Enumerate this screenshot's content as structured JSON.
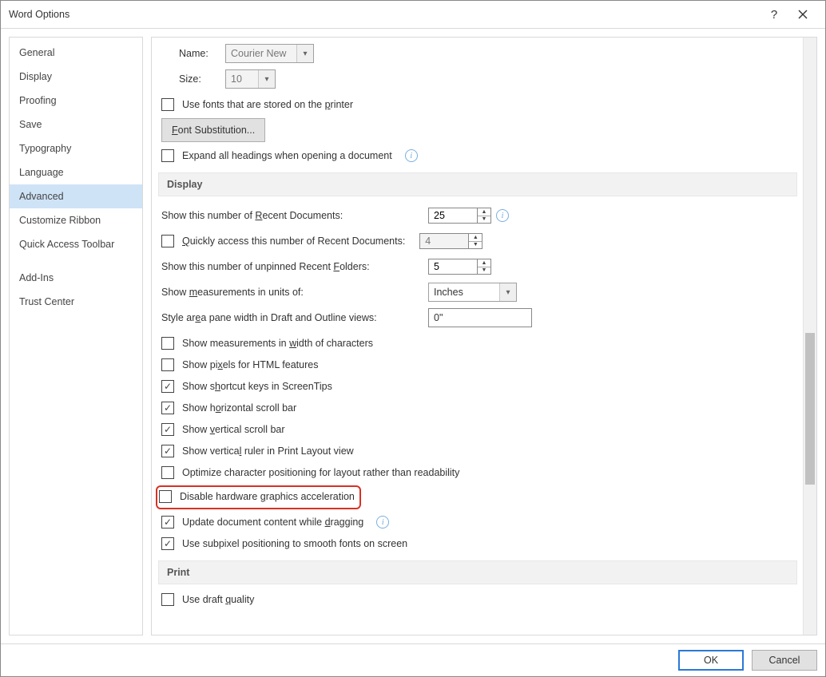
{
  "title": "Word Options",
  "sidebar": {
    "items": [
      {
        "label": "General"
      },
      {
        "label": "Display"
      },
      {
        "label": "Proofing"
      },
      {
        "label": "Save"
      },
      {
        "label": "Typography"
      },
      {
        "label": "Language"
      },
      {
        "label": "Advanced",
        "selected": true
      },
      {
        "label": "Customize Ribbon"
      },
      {
        "label": "Quick Access Toolbar"
      },
      {
        "label": "Add-Ins"
      },
      {
        "label": "Trust Center"
      }
    ]
  },
  "main": {
    "top": {
      "name_label": "Name:",
      "name_value": "Courier New",
      "size_label": "Size:",
      "size_value": "10",
      "printer_fonts": "Use fonts that are stored on the printer",
      "font_sub_btn": "Font Substitution...",
      "expand_headings": "Expand all headings when opening a document"
    },
    "display": {
      "header": "Display",
      "recent_docs_label": "Show this number of Recent Documents:",
      "recent_docs_value": "25",
      "quick_access": "Quickly access this number of Recent Documents:",
      "quick_access_value": "4",
      "unpinned_folders_label": "Show this number of unpinned Recent Folders:",
      "unpinned_folders_value": "5",
      "units_label": "Show measurements in units of:",
      "units_value": "Inches",
      "style_area_label": "Style area pane width in Draft and Outline views:",
      "style_area_value": "0\"",
      "cb_width_chars": "Show measurements in width of characters",
      "cb_pixels_html": "Show pixels for HTML features",
      "cb_shortcut": "Show shortcut keys in ScreenTips",
      "cb_hscroll": "Show horizontal scroll bar",
      "cb_vscroll": "Show vertical scroll bar",
      "cb_vruler": "Show vertical ruler in Print Layout view",
      "cb_optimize": "Optimize character positioning for layout rather than readability",
      "cb_disable_hw": "Disable hardware graphics acceleration",
      "cb_update_drag": "Update document content while dragging",
      "cb_subpixel": "Use subpixel positioning to smooth fonts on screen"
    },
    "print": {
      "header": "Print",
      "cb_draft": "Use draft quality"
    }
  },
  "footer": {
    "ok": "OK",
    "cancel": "Cancel"
  }
}
